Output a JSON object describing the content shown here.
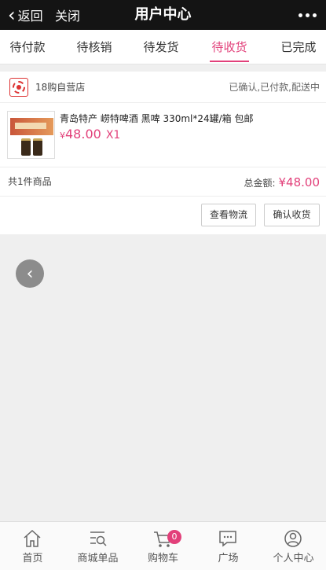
{
  "topbar": {
    "back_label": "返回",
    "close_label": "关闭",
    "title": "用户中心"
  },
  "tabs": [
    {
      "label": "待付款",
      "active": false
    },
    {
      "label": "待核销",
      "active": false
    },
    {
      "label": "待发货",
      "active": false
    },
    {
      "label": "待收货",
      "active": true
    },
    {
      "label": "已完成",
      "active": false
    }
  ],
  "order": {
    "shop_name": "18购自营店",
    "status": "已确认,已付款,配送中",
    "product": {
      "title": "青岛特产 崂特啤酒 黑啤 330ml*24罐/箱 包邮",
      "currency": "¥",
      "price": "48.00",
      "quantity": "X1"
    },
    "count_text": "共1件商品",
    "total_label": "总金额:",
    "total_value": "¥48.00",
    "buttons": {
      "logistics": "查看物流",
      "confirm": "确认收货"
    }
  },
  "bottom_nav": [
    {
      "label": "首页",
      "icon": "home-icon"
    },
    {
      "label": "商城单品",
      "icon": "search-list-icon"
    },
    {
      "label": "购物车",
      "icon": "cart-icon",
      "badge": "0"
    },
    {
      "label": "广场",
      "icon": "chat-icon"
    },
    {
      "label": "个人中心",
      "icon": "user-icon"
    }
  ],
  "colors": {
    "accent": "#e2407a",
    "topbar_bg": "#141414"
  }
}
